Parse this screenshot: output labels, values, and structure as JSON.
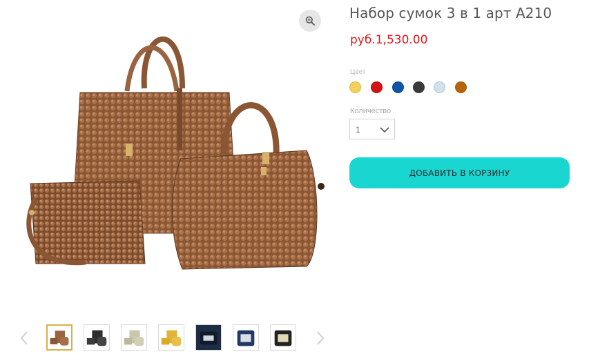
{
  "product": {
    "title": "Набор сумок 3 в 1 арт А210",
    "price": "руб.1,530.00"
  },
  "color": {
    "label": "Цвет",
    "swatches": [
      {
        "name": "yellow",
        "hex": "#f5d05b"
      },
      {
        "name": "red",
        "hex": "#d41013"
      },
      {
        "name": "blue",
        "hex": "#0e56a6"
      },
      {
        "name": "black",
        "hex": "#3a3a3a"
      },
      {
        "name": "light-blue",
        "hex": "#cfe3ea"
      },
      {
        "name": "brown",
        "hex": "#b8640c"
      }
    ]
  },
  "quantity": {
    "label": "Количество",
    "value": "1"
  },
  "cart": {
    "button_label": "ДОБАВИТЬ В КОРЗИНУ"
  },
  "gallery": {
    "icons": {
      "zoom": "zoom-icon",
      "prev": "chevron-left-icon",
      "next": "chevron-right-icon"
    },
    "thumbnail_count": 7,
    "active_index": 0
  },
  "colors": {
    "price": "#e3151a",
    "button": "#19d6d0",
    "active_thumb_border": "#d8b04a"
  }
}
